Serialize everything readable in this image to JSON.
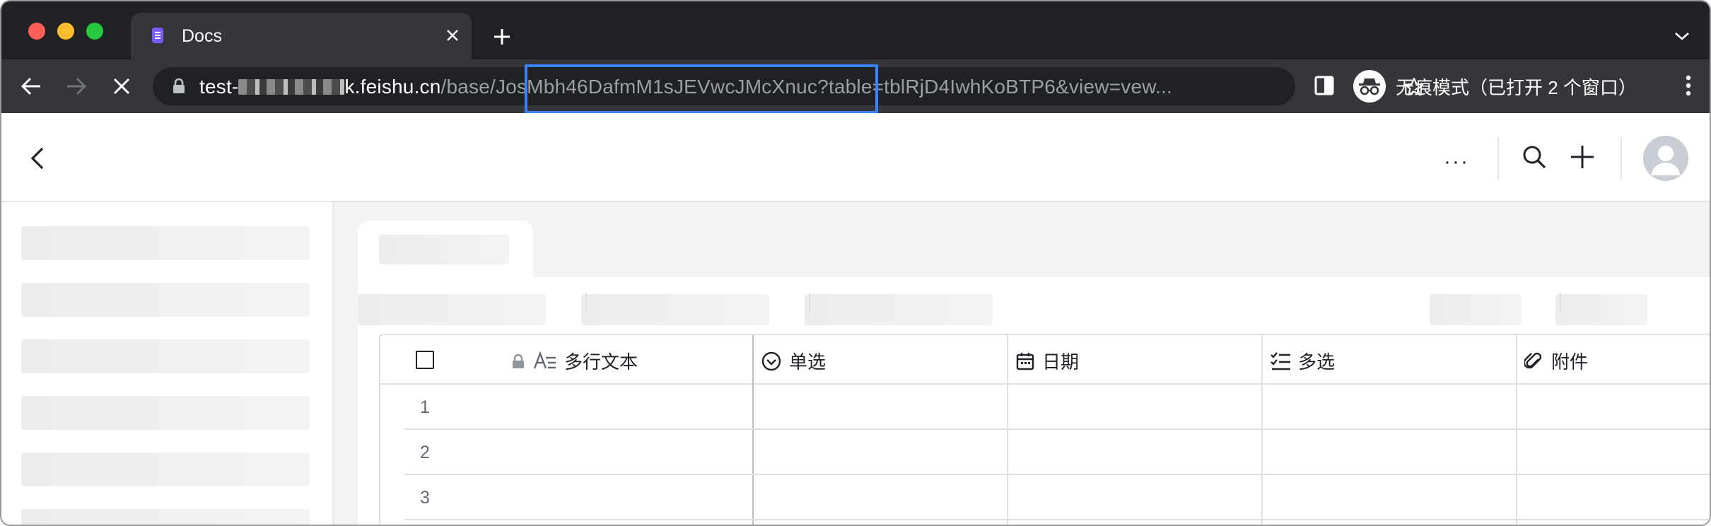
{
  "browser": {
    "tab": {
      "title": "Docs"
    },
    "url": {
      "host_prefix": "test-",
      "host_suffix": "k.feishu.cn",
      "path": "/base/JosMbh46DafmM1sJEVwcJMcXnuc?table=tblRjD4IwhKoBTP6&view=vew..."
    },
    "incognito_label": "无痕模式（已打开 2 个窗口）",
    "colors": {
      "frame": "#202124",
      "toolbar": "#35363a",
      "highlight": "#3b82f6"
    }
  },
  "app": {
    "header": {
      "more_label": "···"
    }
  },
  "grid": {
    "columns": [
      {
        "label": "多行文本",
        "icon": "multiline-text-icon",
        "locked": true
      },
      {
        "label": "单选",
        "icon": "single-select-icon"
      },
      {
        "label": "日期",
        "icon": "calendar-icon"
      },
      {
        "label": "多选",
        "icon": "multi-select-icon"
      },
      {
        "label": "附件",
        "icon": "paperclip-icon"
      }
    ],
    "rows": [
      "1",
      "2",
      "3"
    ]
  }
}
